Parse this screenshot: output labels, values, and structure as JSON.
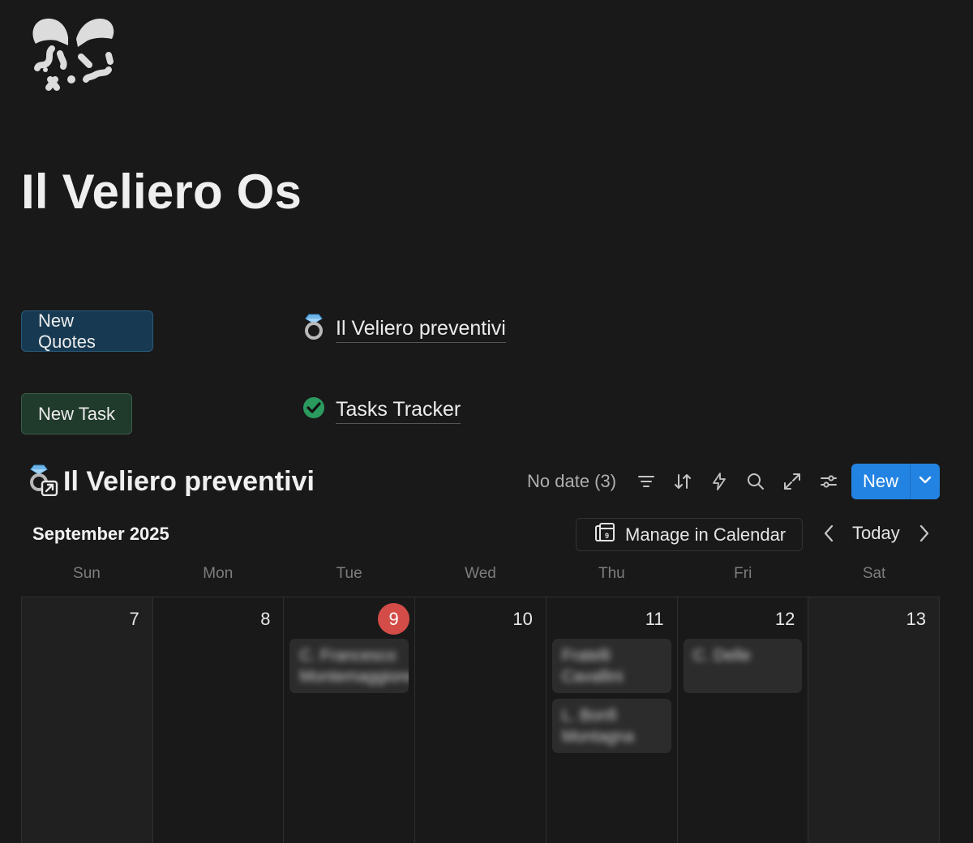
{
  "page": {
    "icon": "confetti-icon",
    "title": "Il Veliero Os"
  },
  "buttons": {
    "new_quotes": "New Quotes",
    "new_task": "New Task"
  },
  "links": {
    "quotes": {
      "icon": "ring-icon",
      "label": "Il Veliero preventivi"
    },
    "tasks": {
      "icon": "check-circle-icon",
      "label": "Tasks Tracker"
    }
  },
  "database": {
    "icon": "ring-icon",
    "title": "Il Veliero preventivi",
    "no_date": "No date (3)",
    "tools": [
      "filter-icon",
      "sort-icon",
      "automation-bolt-icon",
      "search-icon",
      "expand-icon",
      "settings-sliders-icon"
    ],
    "new_label": "New"
  },
  "calendar": {
    "month": "September 2025",
    "manage_label": "Manage in Calendar",
    "today_label": "Today",
    "weekdays": [
      "Sun",
      "Mon",
      "Tue",
      "Wed",
      "Thu",
      "Fri",
      "Sat"
    ],
    "days": [
      "7",
      "8",
      "9",
      "10",
      "11",
      "12",
      "13"
    ],
    "today_index": 2,
    "events": {
      "tue": [
        {
          "line1": "C. Francesco",
          "line2": "Montemaggiore"
        }
      ],
      "thu": [
        {
          "line1": "Fratelli",
          "line2": "Cavallini"
        },
        {
          "line1": "L. Bonfi",
          "line2": "Montagna"
        }
      ],
      "fri": [
        {
          "line1": "C. Delle",
          "line2": ""
        }
      ]
    },
    "colors": {
      "today_badge": "#d44c47",
      "primary": "#2383e2"
    }
  }
}
